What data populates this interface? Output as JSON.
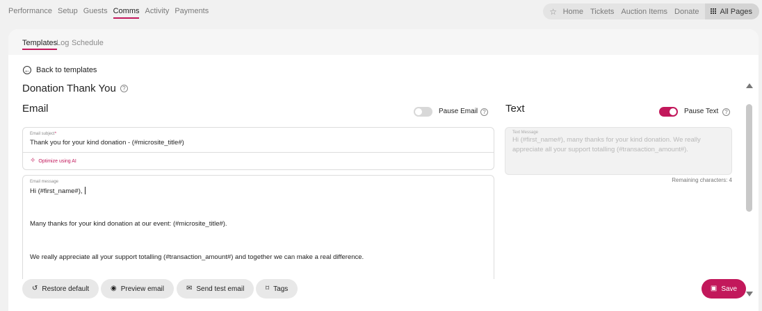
{
  "nav": {
    "tabs": [
      "Performance",
      "Setup",
      "Guests",
      "Comms",
      "Activity",
      "Payments"
    ],
    "active_tab": "Comms",
    "quick_links": [
      "Home",
      "Tickets",
      "Auction Items",
      "Donate"
    ],
    "all_pages": "All Pages"
  },
  "subtabs": [
    "Templates",
    "Log",
    "Schedule"
  ],
  "back_label": "Back to templates",
  "template_title": "Donation Thank You",
  "email": {
    "heading": "Email",
    "pause_label": "Pause Email",
    "pause_on": false,
    "subject_label": "Email subject",
    "subject_value": "Thank you for your kind donation - (#microsite_title#)",
    "optimize_label": "Optimize using AI",
    "message_label": "Email message",
    "message_lines": [
      "Hi (#first_name#),",
      "Many thanks for your kind donation at our event: (#microsite_title#).",
      "We really appreciate all your support totalling (#transaction_amount#) and together we can make a real difference."
    ]
  },
  "text": {
    "heading": "Text",
    "pause_label": "Pause Text",
    "pause_on": true,
    "message_label": "Text Message",
    "message_value": "Hi (#first_name#), many thanks for your kind donation. We really appreciate all your support totalling (#transaction_amount#).",
    "remaining": "Remaining characters: 4"
  },
  "buttons": {
    "restore": "Restore default",
    "preview": "Preview email",
    "send_test": "Send test email",
    "tags": "Tags",
    "save": "Save"
  },
  "colors": {
    "accent": "#c2185b"
  }
}
